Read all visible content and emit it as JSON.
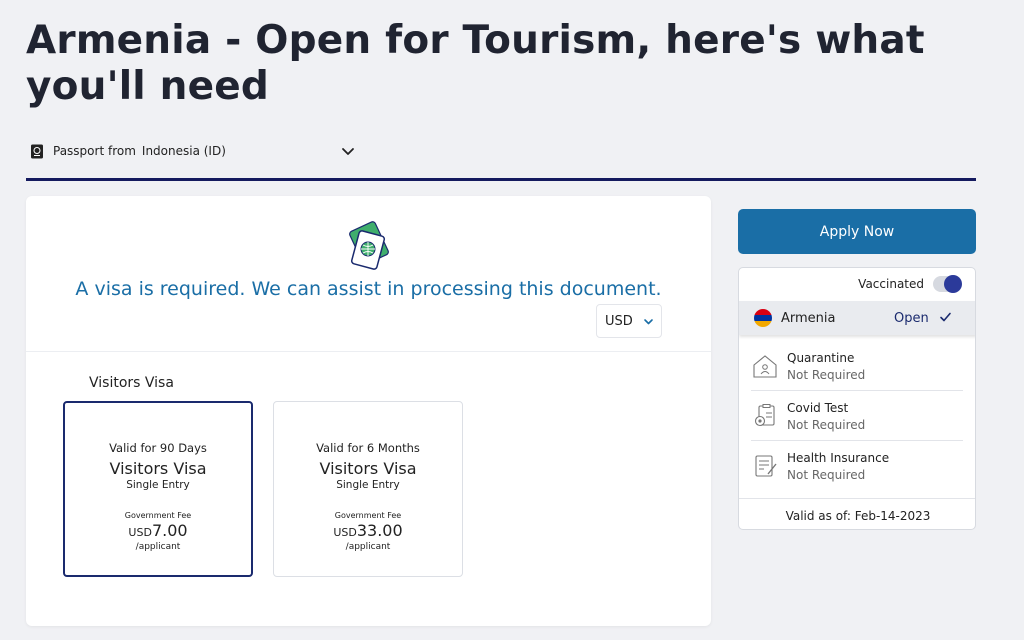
{
  "page": {
    "title": "Armenia - Open for Tourism, here's what you'll need"
  },
  "passport": {
    "label": "Passport from",
    "value": "Indonesia (ID)"
  },
  "visa": {
    "message": "A visa is required. We can assist in processing this document.",
    "currency": "USD",
    "section_label": "Visitors Visa",
    "options": [
      {
        "validity": "Valid for 90 Days",
        "name": "Visitors Visa",
        "entry": "Single Entry",
        "fee_label": "Government Fee",
        "currency": "USD",
        "amount": "7.00",
        "per": "/applicant",
        "selected": true
      },
      {
        "validity": "Valid for 6 Months",
        "name": "Visitors Visa",
        "entry": "Single Entry",
        "fee_label": "Government Fee",
        "currency": "USD",
        "amount": "33.00",
        "per": "/applicant",
        "selected": false
      }
    ]
  },
  "sidebar": {
    "apply_label": "Apply Now",
    "vaccinated_label": "Vaccinated",
    "vaccinated": true,
    "destination": {
      "name": "Armenia",
      "status": "Open"
    },
    "requirements": [
      {
        "label": "Quarantine",
        "value": "Not Required",
        "icon": "quarantine-house-icon"
      },
      {
        "label": "Covid Test",
        "value": "Not Required",
        "icon": "covid-test-icon"
      },
      {
        "label": "Health Insurance",
        "value": "Not Required",
        "icon": "health-insurance-icon"
      }
    ],
    "valid_as_of": "Valid as of: Feb-14-2023"
  },
  "colors": {
    "accent": "#1a6ea6",
    "navy": "#141a5e",
    "flag_red": "#d90012",
    "flag_blue": "#0033a0",
    "flag_orange": "#f2a800"
  }
}
